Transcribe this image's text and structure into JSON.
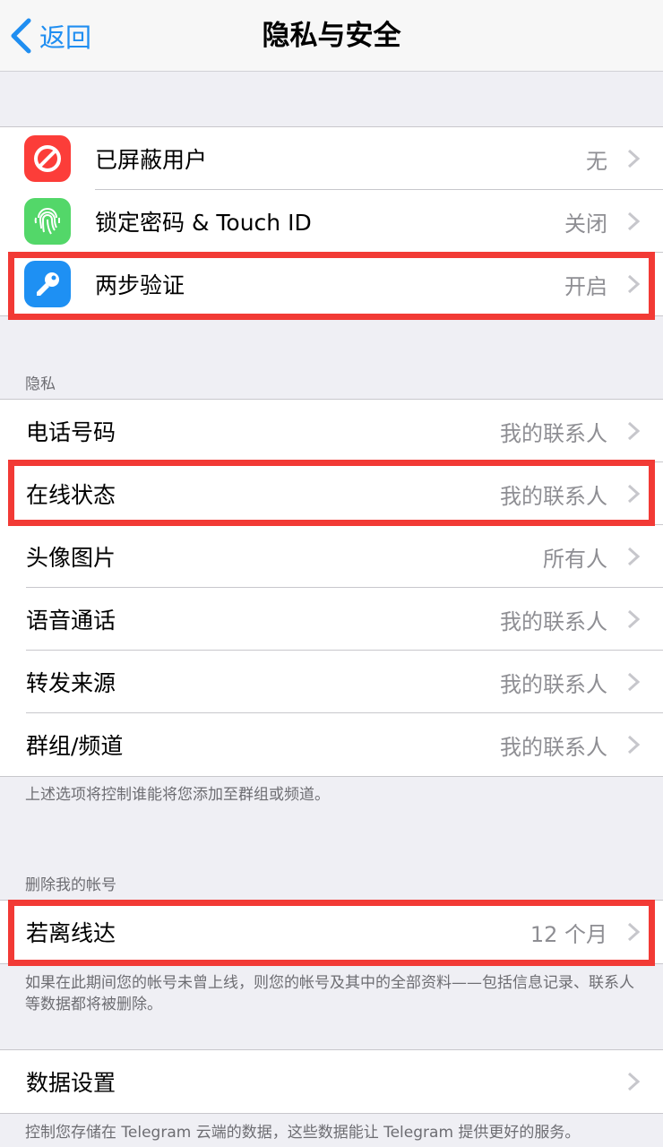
{
  "nav": {
    "back_label": "返回",
    "title": "隐私与安全"
  },
  "security": {
    "items": [
      {
        "label": "已屏蔽用户",
        "value": "无",
        "icon": "blocked-icon",
        "color": "#fc3d39"
      },
      {
        "label": "锁定密码 & Touch ID",
        "value": "关闭",
        "icon": "fingerprint-icon",
        "color": "#53d769"
      },
      {
        "label": "两步验证",
        "value": "开启",
        "icon": "key-icon",
        "color": "#1e90f3"
      }
    ]
  },
  "privacy": {
    "header": "隐私",
    "items": [
      {
        "label": "电话号码",
        "value": "我的联系人"
      },
      {
        "label": "在线状态",
        "value": "我的联系人"
      },
      {
        "label": "头像图片",
        "value": "所有人"
      },
      {
        "label": "语音通话",
        "value": "我的联系人"
      },
      {
        "label": "转发来源",
        "value": "我的联系人"
      },
      {
        "label": "群组/频道",
        "value": "我的联系人"
      }
    ],
    "footer": "上述选项将控制谁能将您添加至群组或频道。"
  },
  "delete_account": {
    "header": "删除我的帐号",
    "label": "若离线达",
    "value": "12 个月",
    "footer": "如果在此期间您的帐号未曾上线，则您的帐号及其中的全部资料——包括信息记录、联系人等数据都将被删除。"
  },
  "data_settings": {
    "label": "数据设置",
    "footer": "控制您存储在 Telegram 云端的数据，这些数据能让 Telegram 提供更好的服务。"
  },
  "colors": {
    "accent": "#1f8ef1",
    "highlight": "#f23a35"
  }
}
